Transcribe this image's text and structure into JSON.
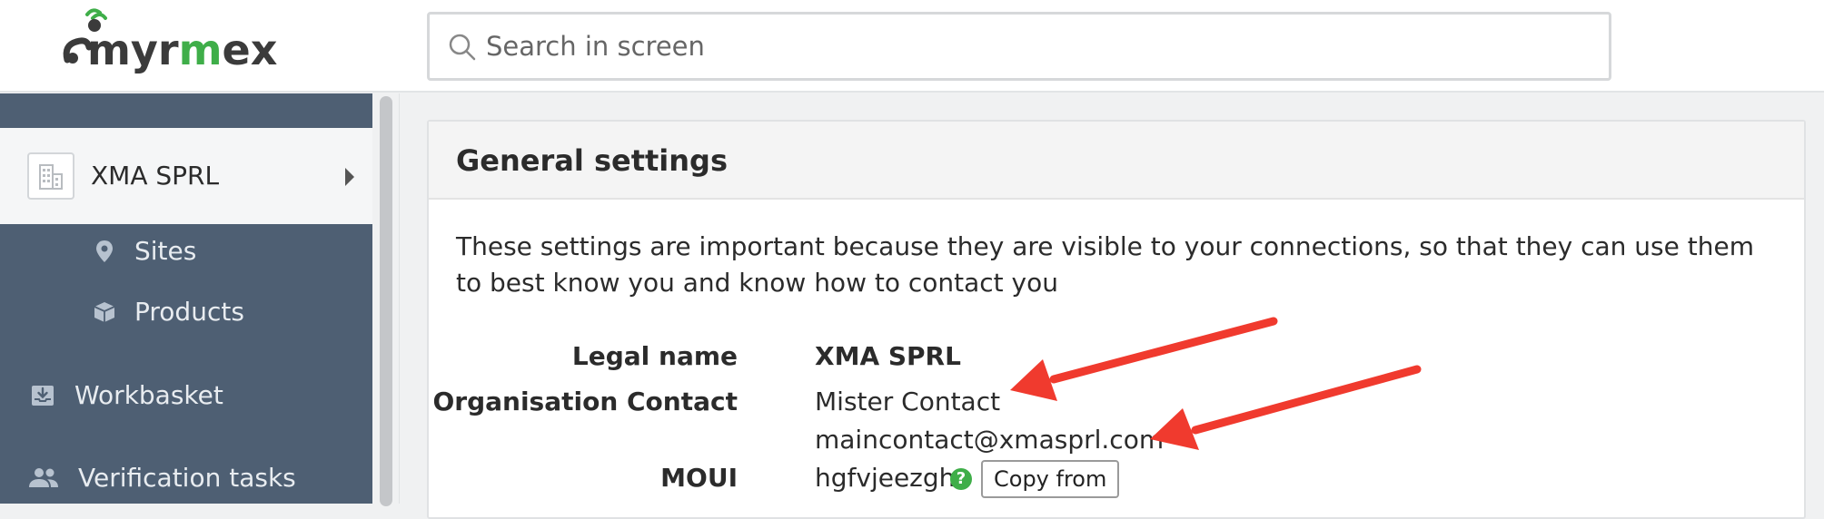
{
  "header": {
    "logo_text_pre": "myr",
    "logo_text_mid": "m",
    "logo_text_post": "ex",
    "search_placeholder": "Search in screen"
  },
  "sidebar": {
    "org_label": "XMA SPRL",
    "items": [
      {
        "label": "Sites",
        "icon": "map-pin-icon"
      },
      {
        "label": "Products",
        "icon": "box-icon"
      },
      {
        "label": "Workbasket",
        "icon": "inbox-icon"
      },
      {
        "label": "Verification tasks",
        "icon": "users-icon"
      }
    ]
  },
  "card": {
    "title": "General settings",
    "description": "These settings are important because they are visible to your connections, so that they can use them to best know you and know how to contact you",
    "fields": {
      "legal_name_label": "Legal name",
      "legal_name_value": "XMA SPRL",
      "org_contact_label": "Organisation Contact",
      "org_contact_name": "Mister Contact",
      "org_contact_email": "maincontact@xmasprl.com",
      "moui_label": "MOUI",
      "moui_value": "hgfvjeezgh",
      "help_glyph": "?",
      "copy_button": "Copy from"
    }
  },
  "colors": {
    "sidebar_bg": "#4e5f73",
    "brand_green": "#3fae49",
    "annotation_red": "#f03a2e"
  }
}
